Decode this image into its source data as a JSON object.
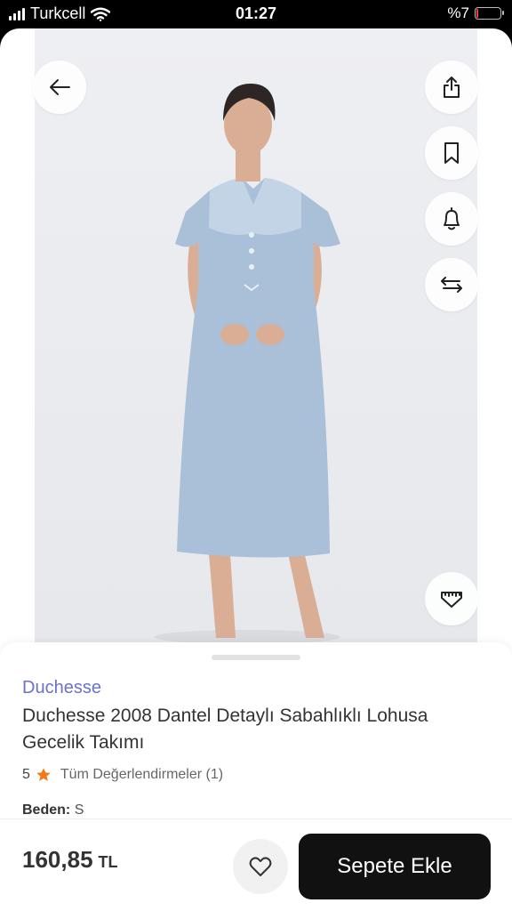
{
  "status_bar": {
    "carrier": "Turkcell",
    "time": "01:27",
    "battery_percent_label": "%7",
    "battery_level": 0.07
  },
  "product": {
    "brand": "Duchesse",
    "title": "Duchesse 2008 Dantel Detaylı Sabahlıklı Lohusa Gecelik Takımı",
    "rating": "5",
    "reviews_link": "Tüm Değerlendirmeler (1)",
    "size_label": "Beden:",
    "size_value": "S",
    "price_value": "160,85",
    "price_currency": "TL"
  },
  "actions": {
    "add_to_cart": "Sepete Ekle"
  },
  "colors": {
    "brand": "#6a72c9",
    "star": "#f27a1a",
    "primary_button": "#111111",
    "dress": "#a9c0d8"
  },
  "icons": [
    "back-arrow-icon",
    "share-icon",
    "bookmark-icon",
    "bell-icon",
    "compare-arrows-icon",
    "size-ruler-icon",
    "heart-icon",
    "star-icon"
  ]
}
